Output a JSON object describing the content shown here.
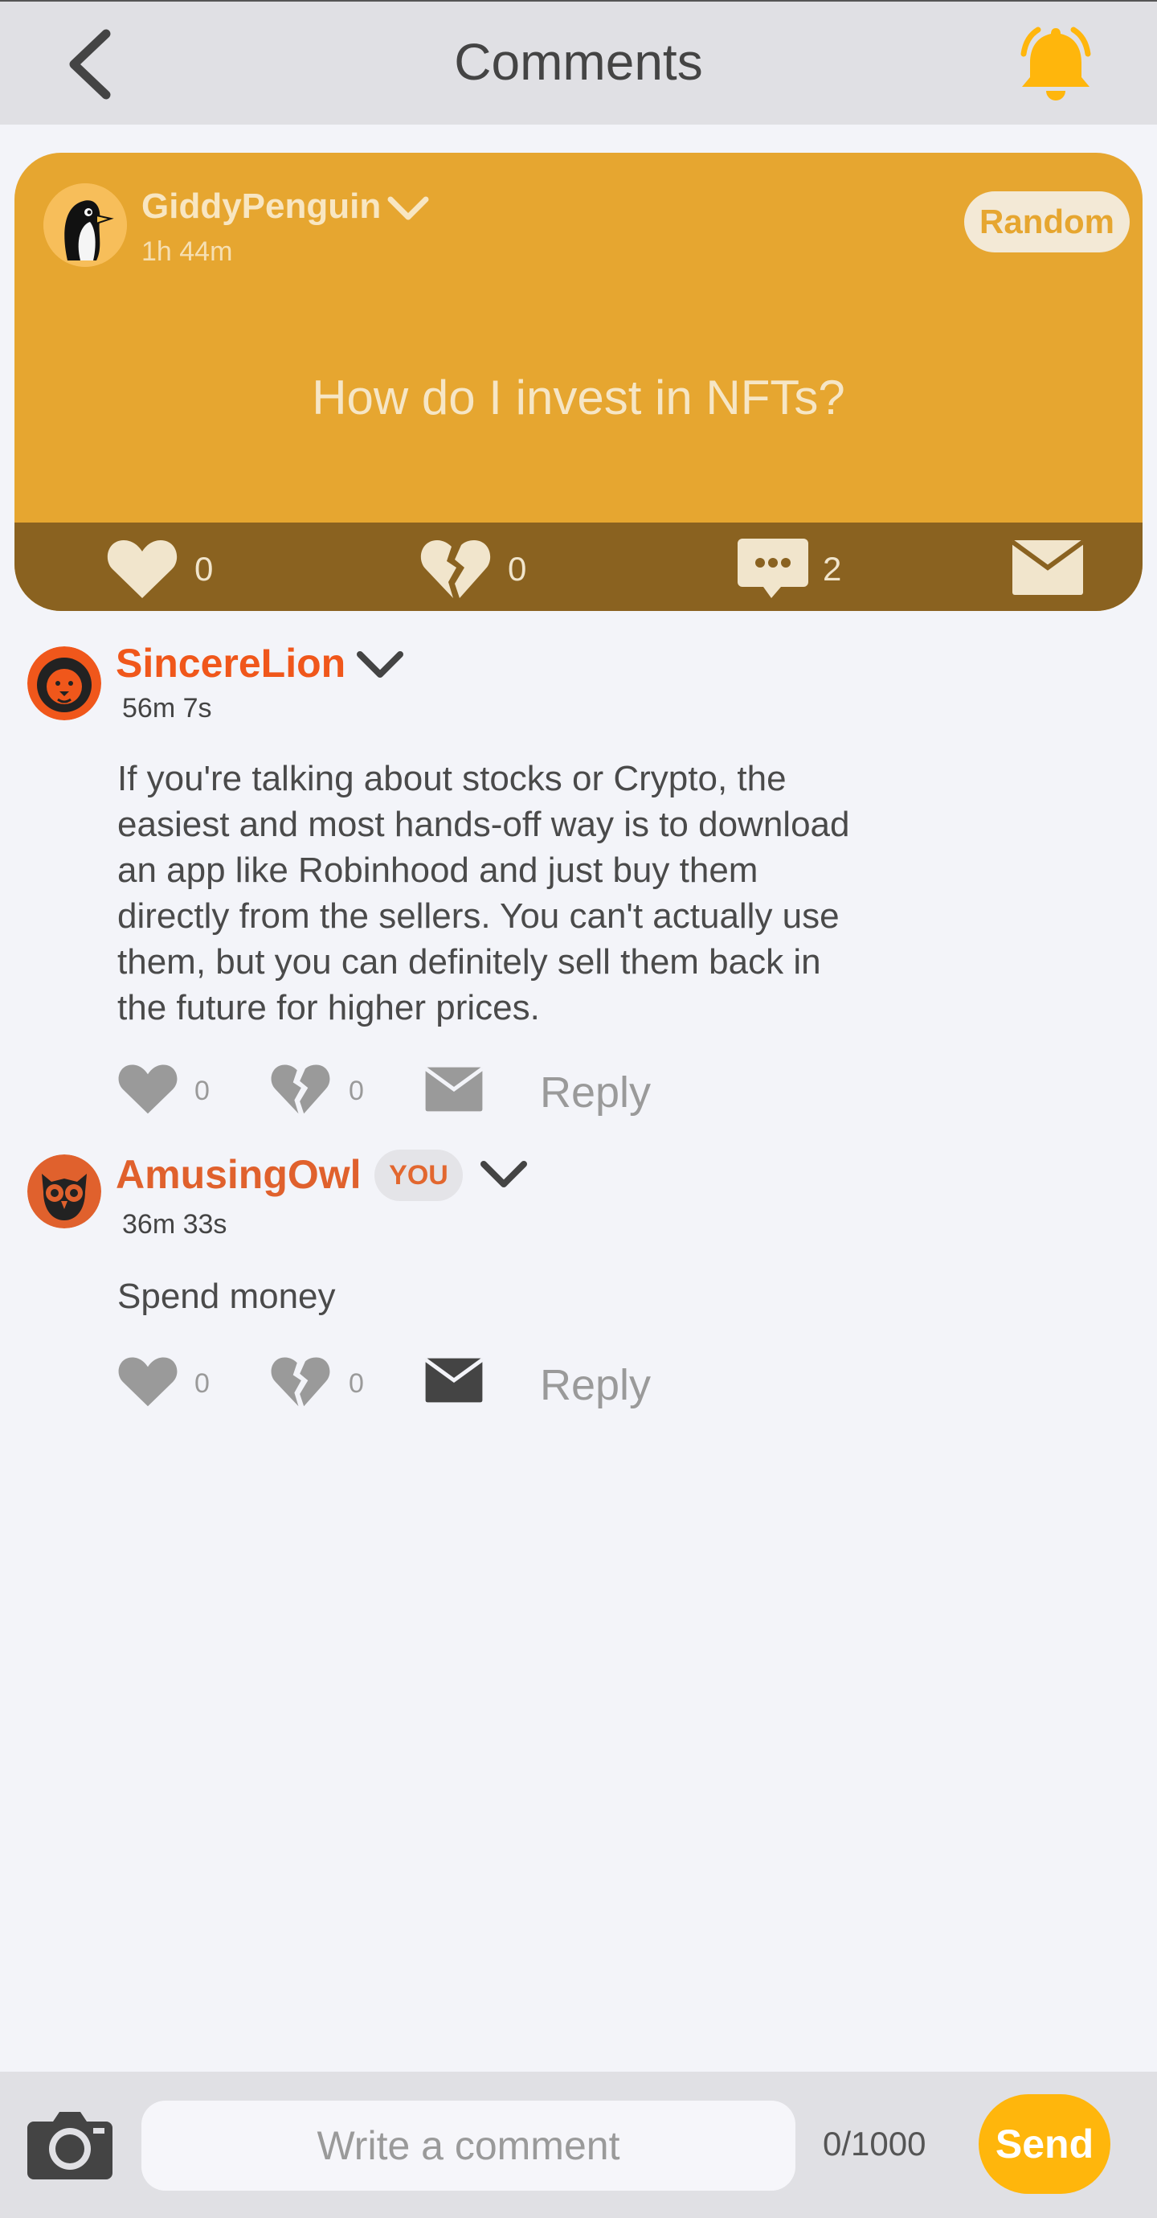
{
  "header": {
    "title": "Comments",
    "back_icon": "chevron-left-icon",
    "bell_icon": "bell-ringing-icon",
    "accent": "#ffb60c"
  },
  "post": {
    "username": "GiddyPenguin",
    "time": "1h 44m",
    "tag": "Random",
    "question": "How do I invest in NFTs?",
    "likes": "0",
    "dislikes": "0",
    "comments": "2",
    "card_color": "#e6a630",
    "bar_color": "#8a6220"
  },
  "comments": [
    {
      "username": "SincereLion",
      "name_color": "#f0571b",
      "time": "56m 7s",
      "text_lines": [
        "If you're talking about stocks or Crypto, the",
        "easiest and most hands-off way is to download",
        "an app like Robinhood and just buy them",
        "directly from the sellers. You can't actually use",
        "them, but you can definitely sell them back in",
        "the future for higher prices."
      ],
      "likes": "0",
      "dislikes": "0",
      "reply_label": "Reply"
    },
    {
      "username": "AmusingOwl",
      "name_color": "#e0612d",
      "badge": "YOU",
      "time": "36m 33s",
      "text_lines": [
        "Spend money"
      ],
      "likes": "0",
      "dislikes": "0",
      "reply_label": "Reply"
    }
  ],
  "composer": {
    "placeholder": "Write a comment",
    "char_count": "0/1000",
    "send_label": "Send",
    "camera_icon": "camera-icon"
  }
}
